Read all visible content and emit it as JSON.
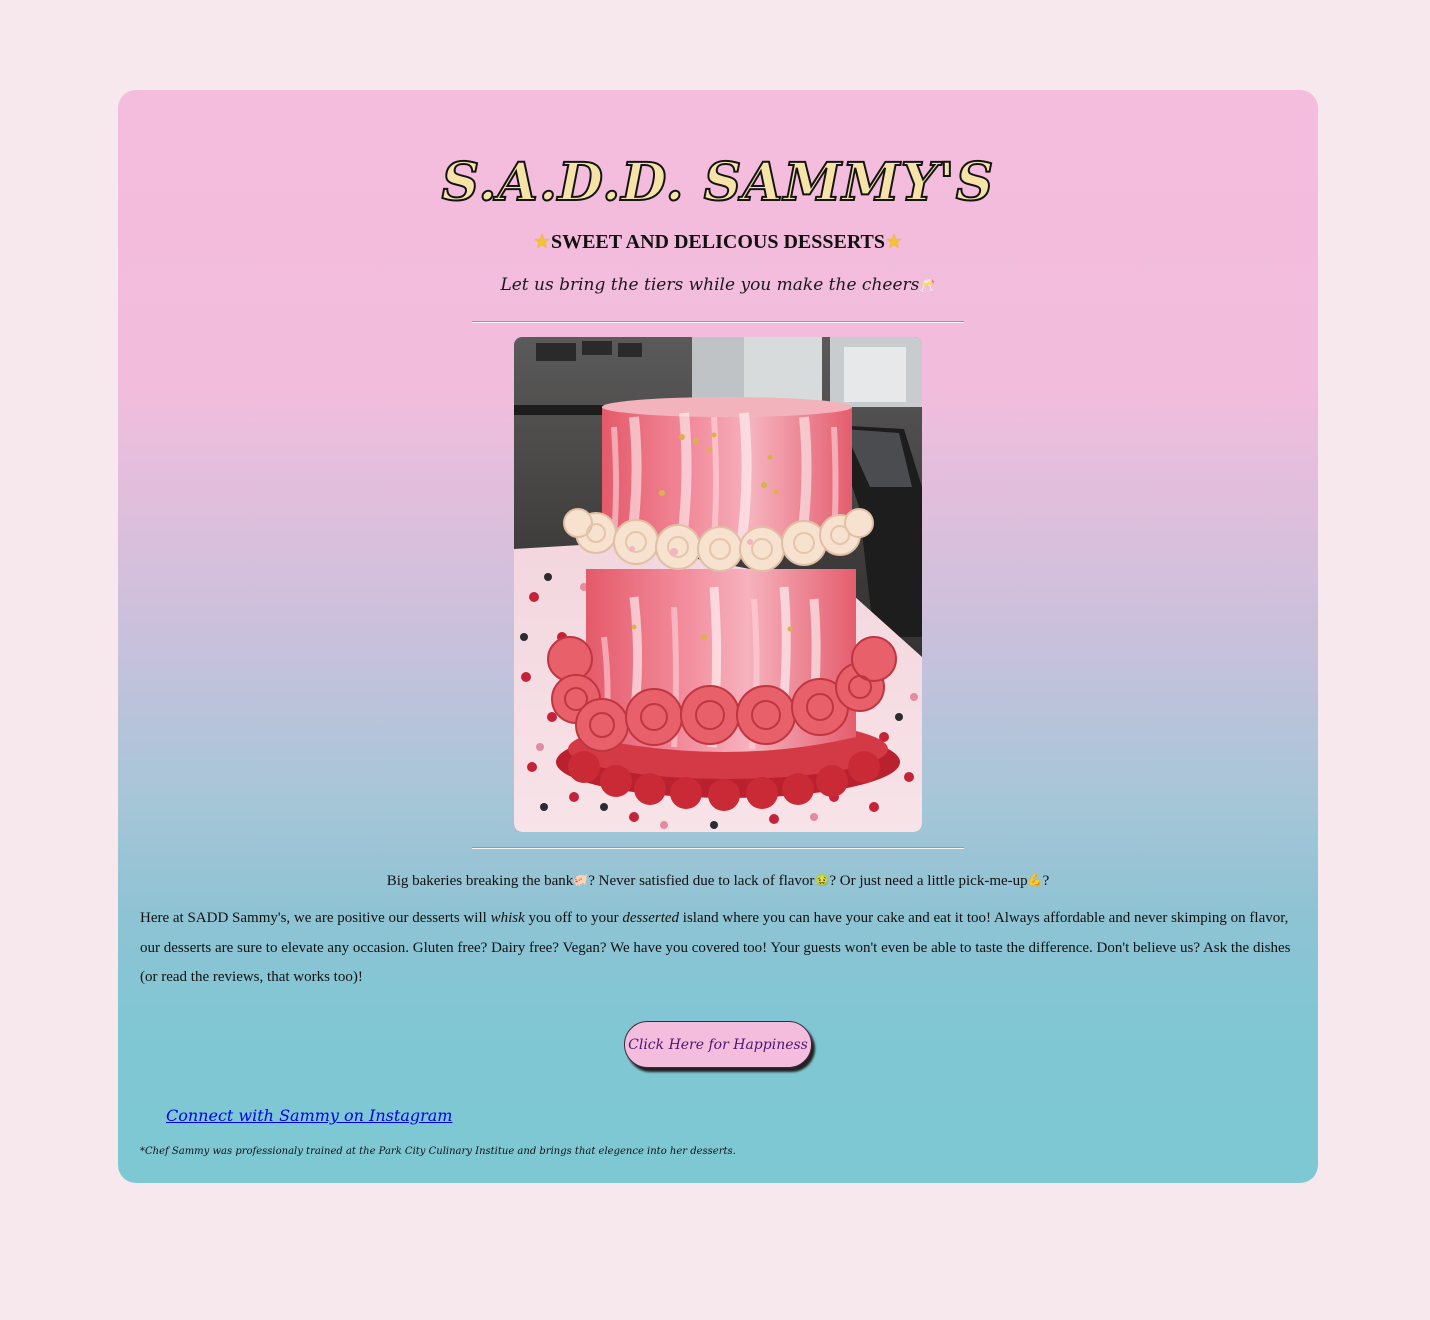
{
  "header": {
    "brand": "S.A.D.D. SAMMY'S",
    "subtitle": "SWEET AND DELICOUS DESSERTS",
    "subtitle_icon": "glowing-star-emoji",
    "tagline_part1": "Let us bring the ",
    "tagline_emphasis": "tiers",
    "tagline_part2": " while you make the cheers",
    "tagline_icon": "clinking-glasses-emoji"
  },
  "hero": {
    "image_subject": "two-tier pink cake with roses"
  },
  "intro": {
    "q1": "Big bakeries breaking the bank",
    "q1_icon": "piggy-bank-emoji",
    "q2": "? Never satisfied due to lack of flavor",
    "q2_icon": "nauseated-face-emoji",
    "q3": "? Or just need a little pick-me-up",
    "q3_icon": "flexed-biceps-emoji",
    "q3_end": "?"
  },
  "body": {
    "p1": "Here at SADD Sammy's, we are positive our desserts will ",
    "em1": "whisk",
    "p2": " you off to your ",
    "em2": "desserted",
    "p3": " island where you can have your cake and eat it too! Always affordable and never skimping on flavor, our desserts are sure to elevate any occasion. Gluten free? Dairy free? Vegan? We have you covered too! Your guests won't even be able to taste the difference. Don't believe us? Ask the dishes (or read the reviews, that works too)!"
  },
  "cta": {
    "label": "Click Here for Happiness"
  },
  "footer": {
    "instagram_link": "Connect with Sammy on Instagram",
    "footnote": "*Chef Sammy was professionaly trained at the Park City Culinary Institue and brings that elegence into her desserts."
  },
  "colors": {
    "page_bg": "#f6e8ec",
    "card_top": "#f4bcdd",
    "card_bottom": "#7ec8d3",
    "button_bg": "#f4bcdd",
    "button_text": "#4b1770",
    "link": "#0000ee"
  }
}
